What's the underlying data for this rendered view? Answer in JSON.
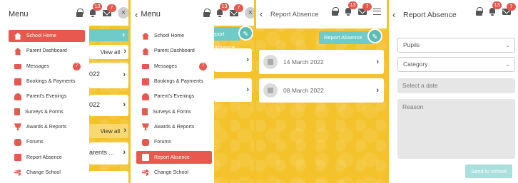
{
  "menu": {
    "title": "Menu",
    "items": [
      {
        "label": "School Home",
        "icon": "house-icon"
      },
      {
        "label": "Parent Dashboard",
        "icon": "house-icon"
      },
      {
        "label": "Messages",
        "icon": "mail-icon",
        "count": "7"
      },
      {
        "label": "Bookings & Payments",
        "icon": "calendar-icon"
      },
      {
        "label": "Parent's Evenings",
        "icon": "people-icon"
      },
      {
        "label": "Surveys & Forms",
        "icon": "form-icon"
      },
      {
        "label": "Awards & Reports",
        "icon": "trophy-icon"
      },
      {
        "label": "Forums",
        "icon": "forum-icon"
      },
      {
        "label": "Report Absence",
        "icon": "report-icon"
      },
      {
        "label": "Change School",
        "icon": "shuffle-icon"
      }
    ]
  },
  "header": {
    "notifications_count": "13",
    "messages_count": "7",
    "close_glyph": "×",
    "back_glyph": "‹"
  },
  "panel1": {
    "view_all_1": "View all",
    "view_all_2": "View all",
    "fragment_1": "022",
    "fragment_2": "022",
    "fragment_3": "arents ..."
  },
  "panel2": {
    "report_absence_fragment": "Report Absence"
  },
  "panel3": {
    "title": "Report Absence",
    "report_button": "Report Absence",
    "dates": [
      "14 March 2022",
      "08 March 2022"
    ]
  },
  "panel4": {
    "title": "Report Absence",
    "pupils_placeholder": "Pupils",
    "category_placeholder": "Category",
    "date_placeholder": "Select a date",
    "reason_placeholder": "Reason",
    "send_button": "Send to school"
  },
  "colors": {
    "accent": "#e8584f",
    "teal": "#6fcbc7",
    "background": "#f4c22b"
  }
}
